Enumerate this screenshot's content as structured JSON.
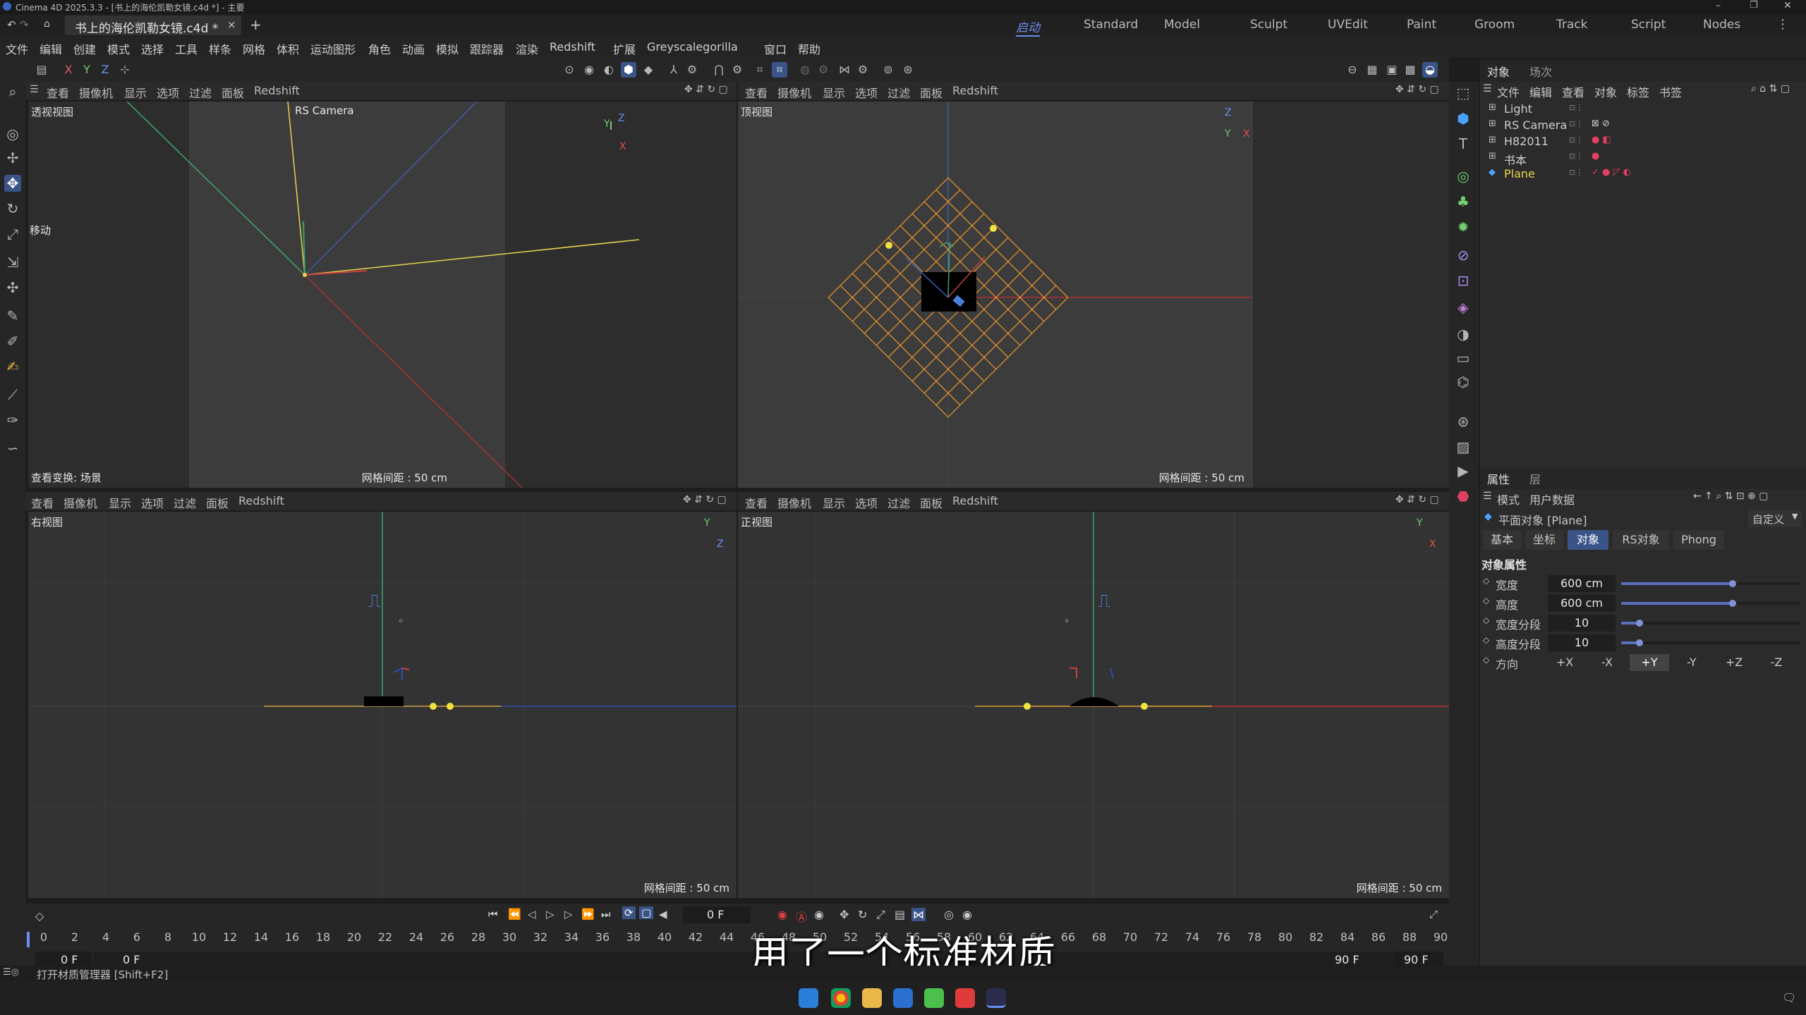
{
  "window": {
    "title": "Cinema 4D 2025.3.3 - [书上的海伦凯勒女镜.c4d *] - 主要"
  },
  "doc_tab": {
    "label": "书上的海伦凯勒女镜.c4d *",
    "close": "×",
    "add": "+"
  },
  "layouts": [
    "启动",
    "Standard",
    "Model",
    "Sculpt",
    "UVEdit",
    "Paint",
    "Groom",
    "Track",
    "Script",
    "Nodes"
  ],
  "menu": [
    "文件",
    "编辑",
    "创建",
    "模式",
    "选择",
    "工具",
    "样条",
    "网格",
    "体积",
    "运动图形",
    "角色",
    "动画",
    "模拟",
    "跟踪器",
    "渲染",
    "Redshift",
    "扩展",
    "Greyscalegorilla",
    "窗口",
    "帮助"
  ],
  "axis_lock": [
    "X",
    "Y",
    "Z"
  ],
  "viewport_menu": [
    "查看",
    "摄像机",
    "显示",
    "选项",
    "过滤",
    "面板",
    "Redshift"
  ],
  "viewports": {
    "perspective": {
      "name": "透视视图",
      "camera": "RS Camera",
      "grid": "网格间距 : 50 cm",
      "transform": "查看变换: 场景",
      "tool": "移动"
    },
    "top": {
      "name": "顶视图",
      "grid": "网格间距 : 50 cm"
    },
    "right": {
      "name": "右视图",
      "grid": "网格间距 : 50 cm"
    },
    "front": {
      "name": "正视图",
      "grid": "网格间距 : 50 cm"
    }
  },
  "object_panel": {
    "tabs": [
      "对象",
      "场次"
    ],
    "menu": [
      "文件",
      "编辑",
      "查看",
      "对象",
      "标签",
      "书签"
    ],
    "objects": [
      {
        "name": "Light",
        "color": "#cfcfcf"
      },
      {
        "name": "RS Camera",
        "color": "#cfcfcf"
      },
      {
        "name": "H82011",
        "color": "#cfcfcf"
      },
      {
        "name": "书本",
        "color": "#cfcfcf"
      },
      {
        "name": "Plane",
        "color": "#e8d44d"
      }
    ]
  },
  "attributes": {
    "tabs": [
      "属性",
      "层"
    ],
    "menu": [
      "模式",
      "用户数据"
    ],
    "object_title": "平面对象 [Plane]",
    "preset": "自定义",
    "subtabs": [
      "基本",
      "坐标",
      "对象",
      "RS对象",
      "Phong"
    ],
    "active_subtab": "对象",
    "section": "对象属性",
    "fields": [
      {
        "label": "宽度",
        "value": "600 cm",
        "fill": 0.62
      },
      {
        "label": "高度",
        "value": "600 cm",
        "fill": 0.62
      },
      {
        "label": "宽度分段",
        "value": "10",
        "fill": 0.1
      },
      {
        "label": "高度分段",
        "value": "10",
        "fill": 0.1
      }
    ],
    "orientation_label": "方向",
    "orientation": [
      "+X",
      "-X",
      "+Y",
      "-Y",
      "+Z",
      "-Z"
    ],
    "orientation_selected": "+Y"
  },
  "timeline": {
    "ticks": [
      "0",
      "2",
      "4",
      "6",
      "8",
      "10",
      "12",
      "14",
      "16",
      "18",
      "20",
      "22",
      "24",
      "26",
      "28",
      "30",
      "32",
      "34",
      "36",
      "38",
      "40",
      "42",
      "44",
      "46",
      "48",
      "50",
      "52",
      "54",
      "56",
      "58",
      "60",
      "62",
      "64",
      "66",
      "68",
      "70",
      "72",
      "74",
      "76",
      "78",
      "80",
      "82",
      "84",
      "86",
      "88",
      "90"
    ],
    "current_frame": "0 F",
    "start": "0 F",
    "start2": "0 F",
    "end": "90 F",
    "end2": "90 F"
  },
  "status": {
    "text": "打开材质管理器 [Shift+F2]"
  },
  "subtitle": "用了一个标准材质"
}
